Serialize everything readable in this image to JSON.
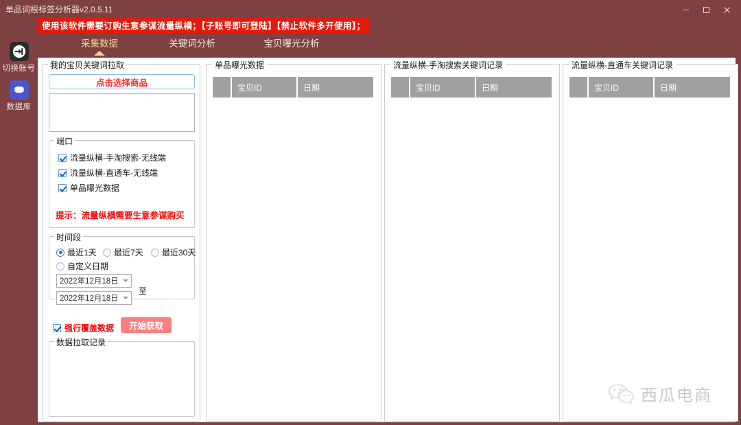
{
  "window": {
    "title": "单品词根标签分析器v2.0.5.11",
    "minimize": "—",
    "maximize": "□",
    "close": "✕"
  },
  "banner": {
    "text": "使用该软件需要订购生意参谋流量纵横；【子账号即可登陆】【禁止软件多开使用】；",
    "bg": "#e41b0c",
    "fg": "#ffffff"
  },
  "theme": {
    "header_bg": "#7e4041",
    "active_tab": "#f2d98c",
    "accent_red": "#fa0a0a",
    "button_pink": "#fb8080",
    "table_header_gray": "#a0a0a0"
  },
  "sidebar": {
    "items": [
      {
        "label": "切换账号",
        "icon": "login-arrow-icon"
      },
      {
        "label": "数据库",
        "icon": "database-icon"
      }
    ]
  },
  "tabs": [
    {
      "label": "采集数据",
      "active": true
    },
    {
      "label": "关键词分析",
      "active": false
    },
    {
      "label": "宝贝曝光分析",
      "active": false
    }
  ],
  "left_panel": {
    "legend": "我的宝贝关键词拉取",
    "select_product_button": "点击选择商品",
    "product_list_value": "",
    "port_group": {
      "legend": "端口",
      "checkboxes": [
        {
          "label": "流量纵横-手淘搜索-无线端",
          "checked": true
        },
        {
          "label": "流量纵横-直通车-无线端",
          "checked": true
        },
        {
          "label": "单品曝光数据",
          "checked": true
        }
      ],
      "hint": "提示：流量纵横需要生意参谋购买"
    },
    "time_group": {
      "legend": "时间段",
      "radios": [
        {
          "label": "最近1天",
          "selected": true
        },
        {
          "label": "最近7天",
          "selected": false
        },
        {
          "label": "最近30天",
          "selected": false
        },
        {
          "label": "自定义日期",
          "selected": false
        }
      ],
      "date_start": "2022年12月18日",
      "date_end": "2022年12月18日",
      "to_label": "至"
    },
    "overwrite_checkbox": {
      "label": "强行覆盖数据",
      "checked": true
    },
    "start_button": "开始获取",
    "log_group": {
      "legend": "数据拉取记录",
      "content": ""
    }
  },
  "panels": [
    {
      "legend": "单品曝光数据",
      "columns": [
        "",
        "宝贝ID",
        "日期"
      ],
      "rows": []
    },
    {
      "legend": "流量纵横-手淘搜索关键词记录",
      "columns": [
        "",
        "宝贝ID",
        "日期"
      ],
      "rows": []
    },
    {
      "legend": "流量纵横-直通车关键词记录",
      "columns": [
        "",
        "宝贝ID",
        "日期"
      ],
      "rows": []
    }
  ],
  "watermark": {
    "text": "西瓜电商",
    "icon": "wechat-icon"
  }
}
